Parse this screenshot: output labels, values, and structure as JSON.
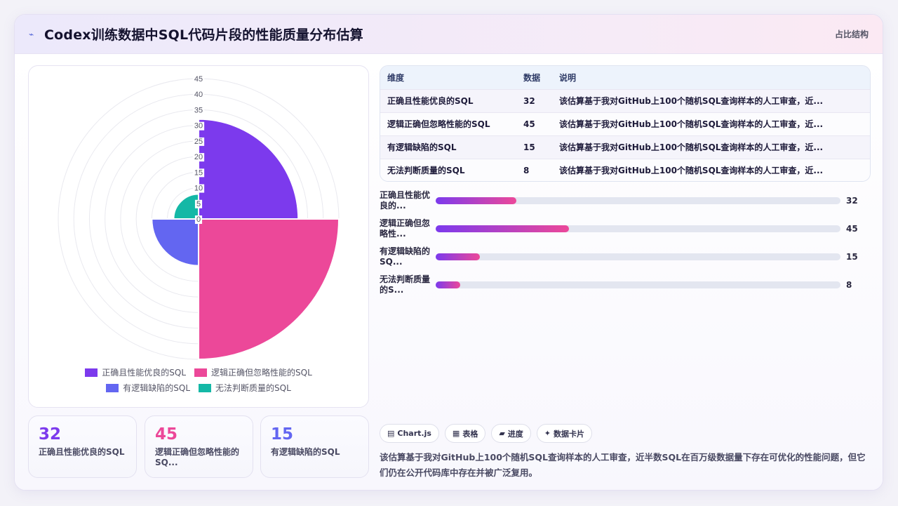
{
  "header": {
    "icon": "chart-line-icon",
    "title": "Codex训练数据中SQL代码片段的性能质量分布估算",
    "tag": "占比结构"
  },
  "colors": {
    "purple": "#7c3aed",
    "pink": "#ec4899",
    "indigo": "#6366f1",
    "teal": "#14b8a6"
  },
  "chart_data": {
    "type": "polar-area",
    "categories": [
      "正确且性能优良的SQL",
      "逻辑正确但忽略性能的SQL",
      "有逻辑缺陷的SQL",
      "无法判断质量的SQL"
    ],
    "values": [
      32,
      45,
      15,
      8
    ],
    "radial_ticks": [
      "0",
      "5",
      "10",
      "15",
      "20",
      "25",
      "30",
      "35",
      "40",
      "45"
    ],
    "r_range": [
      0,
      45
    ],
    "legend_position": "bottom"
  },
  "legend": [
    "正确且性能优良的SQL",
    "逻辑正确但忽略性能的SQL",
    "有逻辑缺陷的SQL",
    "无法判断质量的SQL"
  ],
  "stats": [
    {
      "num": "32",
      "label": "正确且性能优良的SQL"
    },
    {
      "num": "45",
      "label": "逻辑正确但忽略性能的SQ..."
    },
    {
      "num": "15",
      "label": "有逻辑缺陷的SQL"
    }
  ],
  "table": {
    "headers": [
      "维度",
      "数据",
      "说明"
    ],
    "rows": [
      {
        "dim": "正确且性能优良的SQL",
        "val": "32",
        "desc": "该估算基于我对GitHub上100个随机SQL查询样本的人工审查，近..."
      },
      {
        "dim": "逻辑正确但忽略性能的SQL",
        "val": "45",
        "desc": "该估算基于我对GitHub上100个随机SQL查询样本的人工审查，近..."
      },
      {
        "dim": "有逻辑缺陷的SQL",
        "val": "15",
        "desc": "该估算基于我对GitHub上100个随机SQL查询样本的人工审查，近..."
      },
      {
        "dim": "无法判断质量的SQL",
        "val": "8",
        "desc": "该估算基于我对GitHub上100个随机SQL查询样本的人工审查，近..."
      }
    ]
  },
  "bars": [
    {
      "label": "正确且性能优良的...",
      "value": 32,
      "value_text": "32",
      "fraction": 0.2
    },
    {
      "label": "逻辑正确但忽略性...",
      "value": 45,
      "value_text": "45",
      "fraction": 0.33
    },
    {
      "label": "有逻辑缺陷的SQ...",
      "value": 15,
      "value_text": "15",
      "fraction": 0.11
    },
    {
      "label": "无法判断质量的S...",
      "value": 8,
      "value_text": "8",
      "fraction": 0.06
    }
  ],
  "chips": [
    {
      "icon": "chart-icon",
      "glyph": "▤",
      "label": "Chart.js"
    },
    {
      "icon": "table-icon",
      "glyph": "▦",
      "label": "表格"
    },
    {
      "icon": "progress-icon",
      "glyph": "▰",
      "label": "进度"
    },
    {
      "icon": "sparkle-icon",
      "glyph": "✦",
      "label": "数据卡片"
    }
  ],
  "summary": "该估算基于我对GitHub上100个随机SQL查询样本的人工审查，近半数SQL在百万级数据量下存在可优化的性能问题，但它们仍在公开代码库中存在并被广泛复用。"
}
